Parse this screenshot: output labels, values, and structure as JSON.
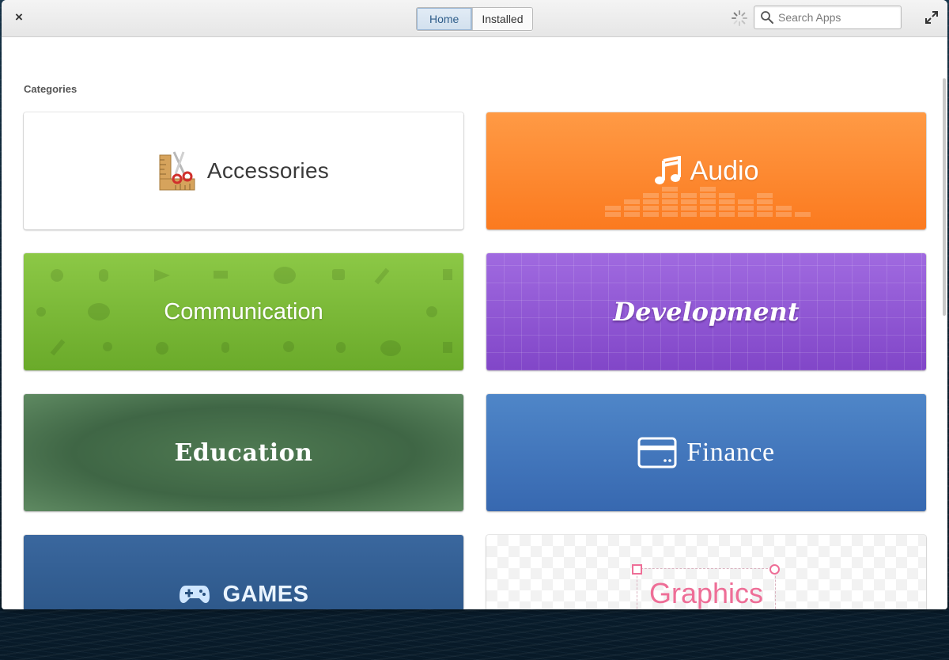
{
  "header": {
    "close_glyph": "×",
    "tabs": [
      {
        "label": "Home",
        "active": true
      },
      {
        "label": "Installed",
        "active": false
      }
    ],
    "search": {
      "placeholder": "Search Apps",
      "value": ""
    }
  },
  "main": {
    "section_title": "Categories",
    "categories": [
      {
        "label": "Accessories",
        "icon": "accessories-scissors-ruler-icon"
      },
      {
        "label": "Audio",
        "icon": "music-note-icon",
        "color": "#fb7a1f"
      },
      {
        "label": "Communication",
        "color": "#7ab83a"
      },
      {
        "label": "Development",
        "color": "#8f57d4"
      },
      {
        "label": "Education",
        "color": "#476f4b"
      },
      {
        "label": "Finance",
        "icon": "credit-card-icon",
        "color": "#4277bd"
      },
      {
        "label": "GAMES",
        "icon": "gamepad-icon",
        "color": "#305c8f"
      },
      {
        "label": "Graphics",
        "color": "#ee6e97"
      }
    ]
  }
}
